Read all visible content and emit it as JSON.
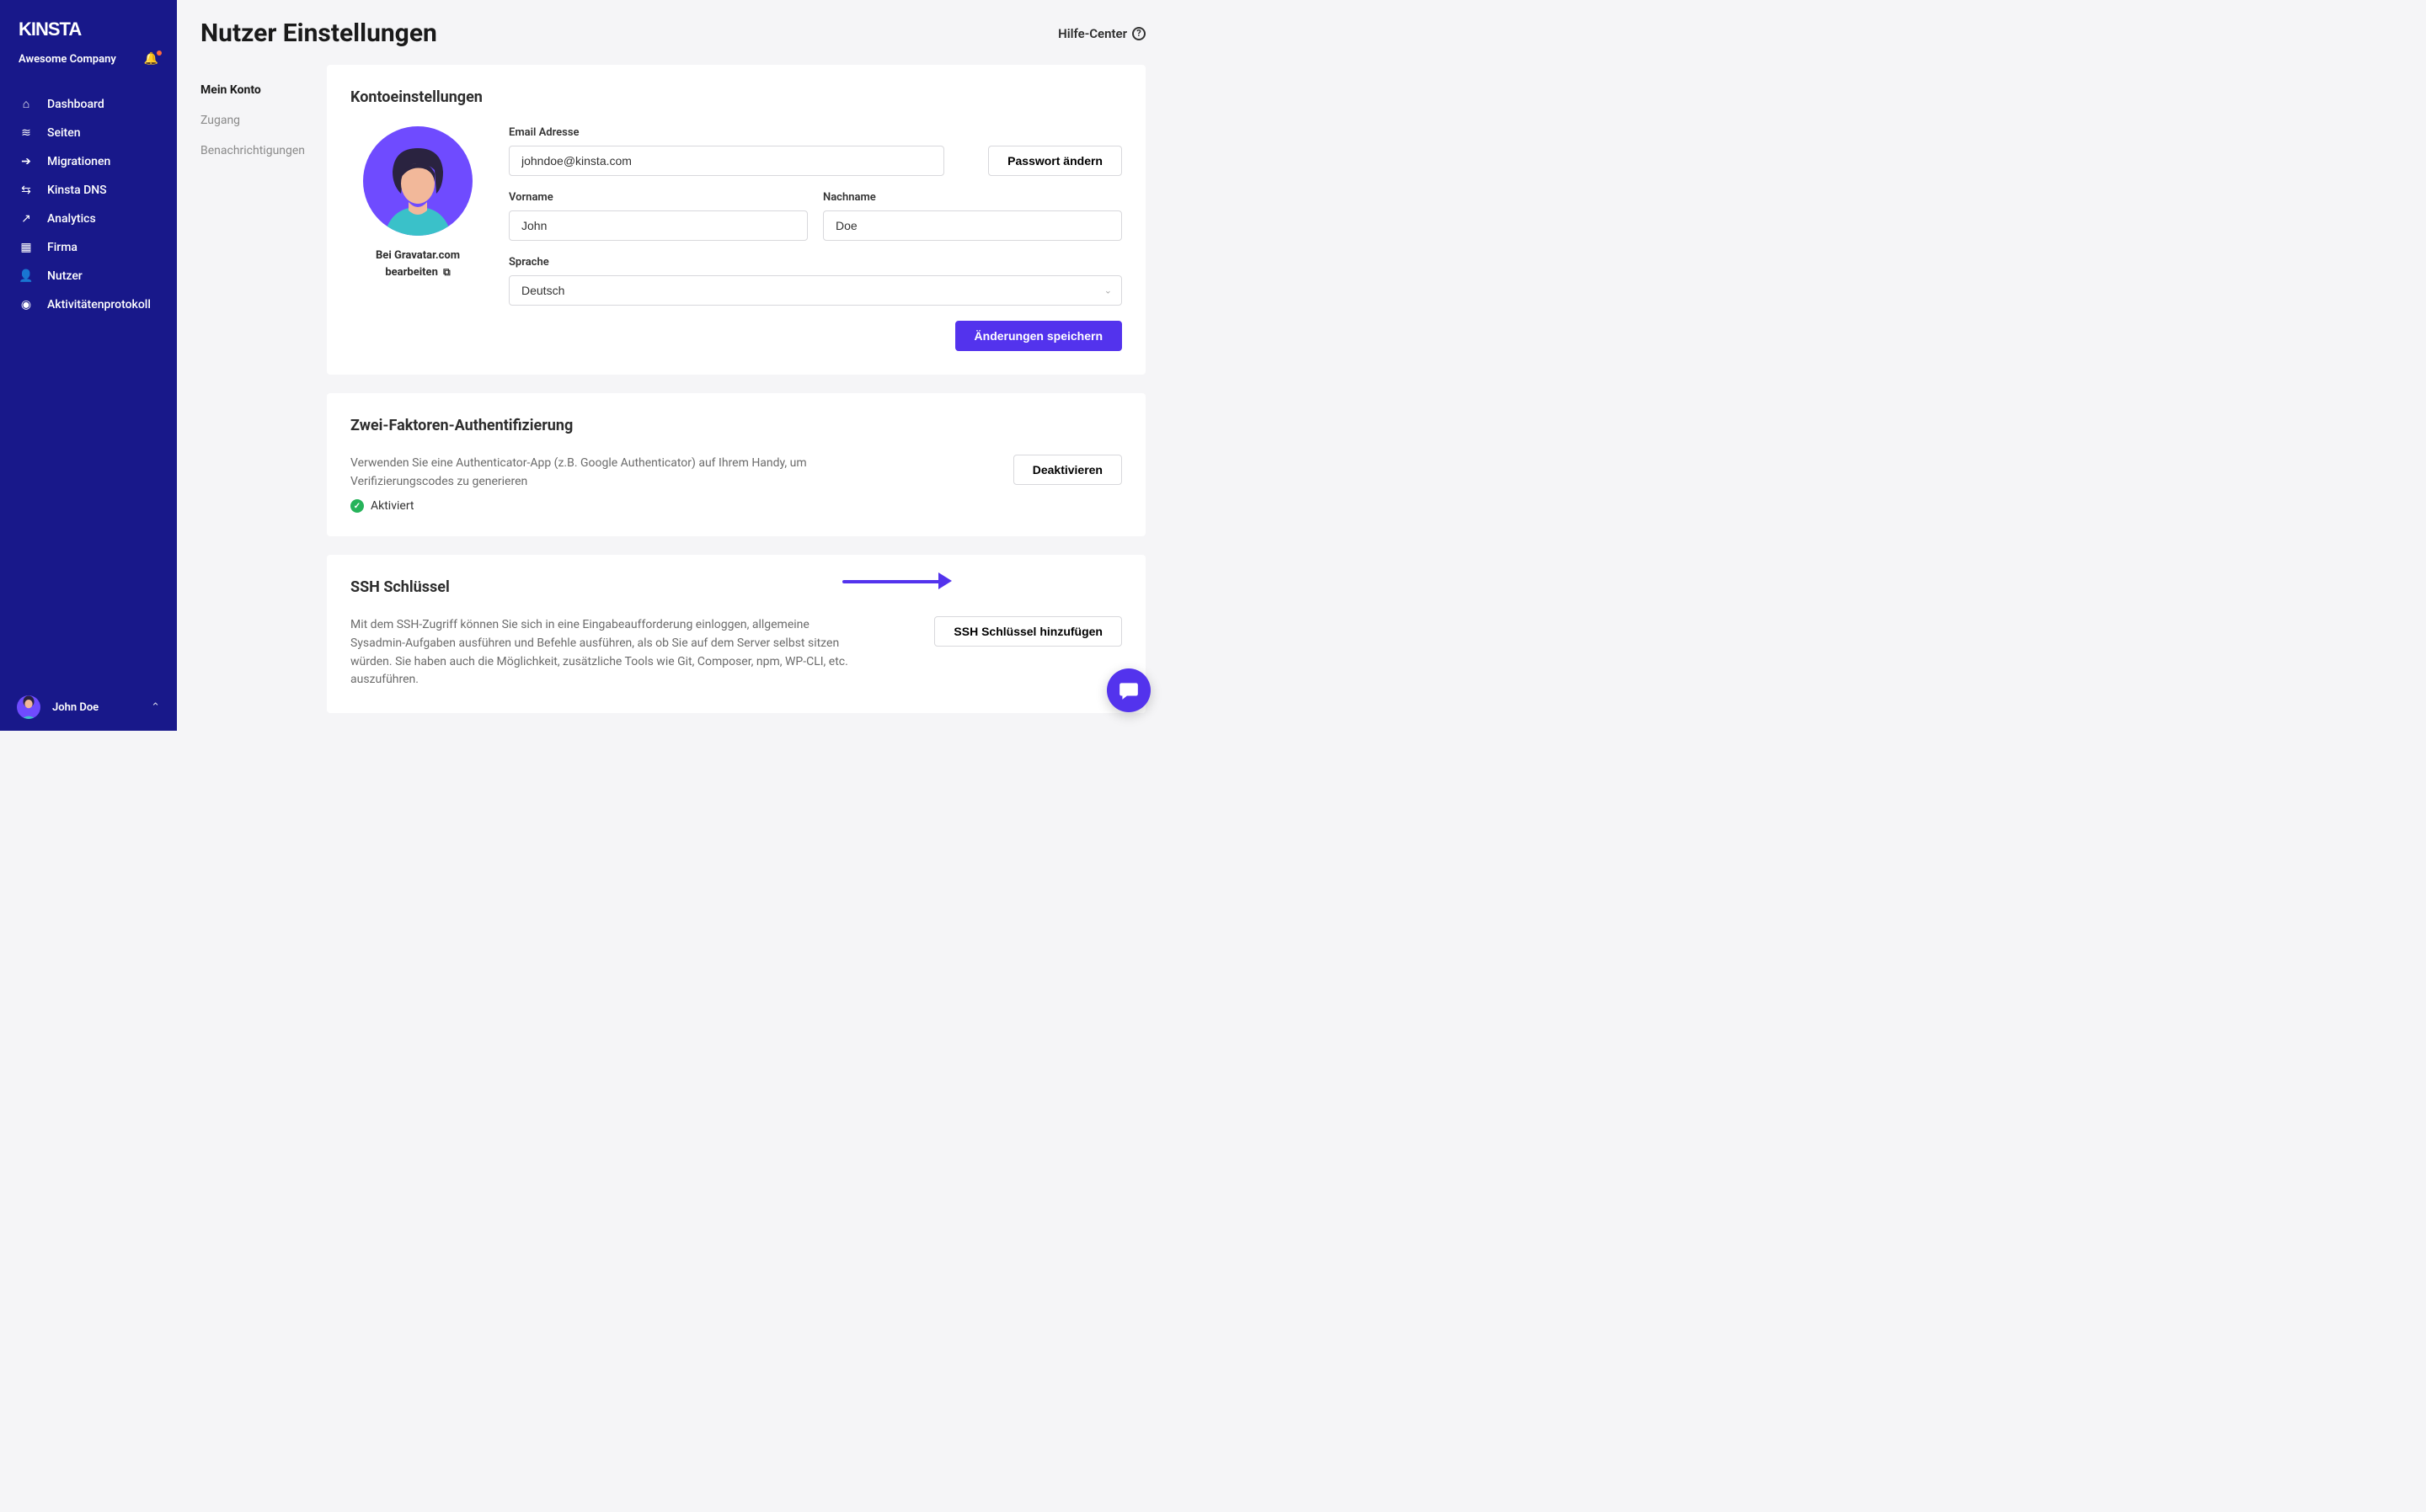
{
  "brand": "KINSTA",
  "company": "Awesome Company",
  "help_center": "Hilfe-Center",
  "page_title": "Nutzer Einstellungen",
  "sidebar": {
    "items": [
      {
        "label": "Dashboard",
        "icon": "⌂"
      },
      {
        "label": "Seiten",
        "icon": "≋"
      },
      {
        "label": "Migrationen",
        "icon": "➔"
      },
      {
        "label": "Kinsta DNS",
        "icon": "⇆"
      },
      {
        "label": "Analytics",
        "icon": "↗"
      },
      {
        "label": "Firma",
        "icon": "▦"
      },
      {
        "label": "Nutzer",
        "icon": "👤"
      },
      {
        "label": "Aktivitätenprotokoll",
        "icon": "◉"
      }
    ]
  },
  "subnav": {
    "items": [
      {
        "label": "Mein Konto",
        "active": true
      },
      {
        "label": "Zugang"
      },
      {
        "label": "Benachrichtigungen"
      }
    ]
  },
  "card1": {
    "title": "Kontoeinstellungen",
    "gravatar_link": "Bei Gravatar.com bearbeiten",
    "email_label": "Email Adresse",
    "email_value": "johndoe@kinsta.com",
    "change_password": "Passwort ändern",
    "firstname_label": "Vorname",
    "firstname_value": "John",
    "lastname_label": "Nachname",
    "lastname_value": "Doe",
    "language_label": "Sprache",
    "language_value": "Deutsch",
    "save": "Änderungen speichern"
  },
  "card2": {
    "title": "Zwei-Faktoren-Authentifizierung",
    "desc": "Verwenden Sie eine Authenticator-App (z.B. Google Authenticator) auf Ihrem Handy, um Verifizierungscodes zu generieren",
    "status": "Aktiviert",
    "deactivate": "Deaktivieren"
  },
  "card3": {
    "title": "SSH Schlüssel",
    "desc": "Mit dem SSH-Zugriff können Sie sich in eine Eingabeaufforderung einloggen, allgemeine Sysadmin-Aufgaben ausführen und Befehle ausführen, als ob Sie auf dem Server selbst sitzen würden. Sie haben auch die Möglichkeit, zusätzliche Tools wie Git, Composer, npm, WP-CLI, etc. auszuführen.",
    "add": "SSH Schlüssel hinzufügen"
  },
  "user": {
    "name": "John Doe"
  }
}
